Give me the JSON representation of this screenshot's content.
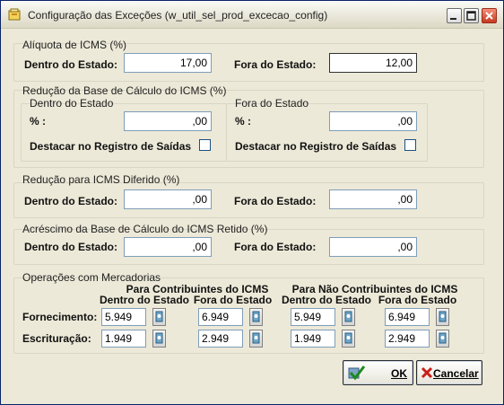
{
  "window": {
    "title": "Configuração das Exceções (w_util_sel_prod_excecao_config)"
  },
  "aliquota": {
    "title": "Alíquota de ICMS (%)",
    "dentro_label": "Dentro do Estado:",
    "dentro_value": "17,00",
    "fora_label": "Fora do Estado:",
    "fora_value": "12,00"
  },
  "reducao": {
    "title": "Redução da Base de Cálculo do ICMS (%)",
    "dentro": {
      "title": "Dentro do Estado",
      "pct_label": "% :",
      "value": ",00",
      "destacar_label": "Destacar no Registro de Saídas",
      "checked": false
    },
    "fora": {
      "title": "Fora do Estado",
      "pct_label": "% :",
      "value": ",00",
      "destacar_label": "Destacar no Registro de Saídas",
      "checked": false
    }
  },
  "diferido": {
    "title": "Redução para ICMS Diferido (%)",
    "dentro_label": "Dentro do Estado:",
    "dentro_value": ",00",
    "fora_label": "Fora do Estado:",
    "fora_value": ",00"
  },
  "acrescimo": {
    "title": "Acréscimo da Base de Cálculo do ICMS Retido (%)",
    "dentro_label": "Dentro do Estado:",
    "dentro_value": ",00",
    "fora_label": "Fora do Estado:",
    "fora_value": ",00"
  },
  "operacoes": {
    "title": "Operações com Mercadorias",
    "contrib_header": "Para Contribuintes do ICMS",
    "nao_contrib_header": "Para Não Contribuintes do ICMS",
    "col_dentro": "Dentro do Estado",
    "col_fora": "Fora do Estado",
    "fornecimento_label": "Fornecimento:",
    "escrituracao_label": "Escrituração:",
    "fornecimento": [
      "5.949",
      "6.949",
      "5.949",
      "6.949"
    ],
    "escrituracao": [
      "1.949",
      "2.949",
      "1.949",
      "2.949"
    ]
  },
  "buttons": {
    "ok": "OK",
    "cancel": "Cancelar"
  },
  "icons": {
    "ok": "check-icon",
    "cancel": "x-icon",
    "lookup": "lookup-icon"
  }
}
